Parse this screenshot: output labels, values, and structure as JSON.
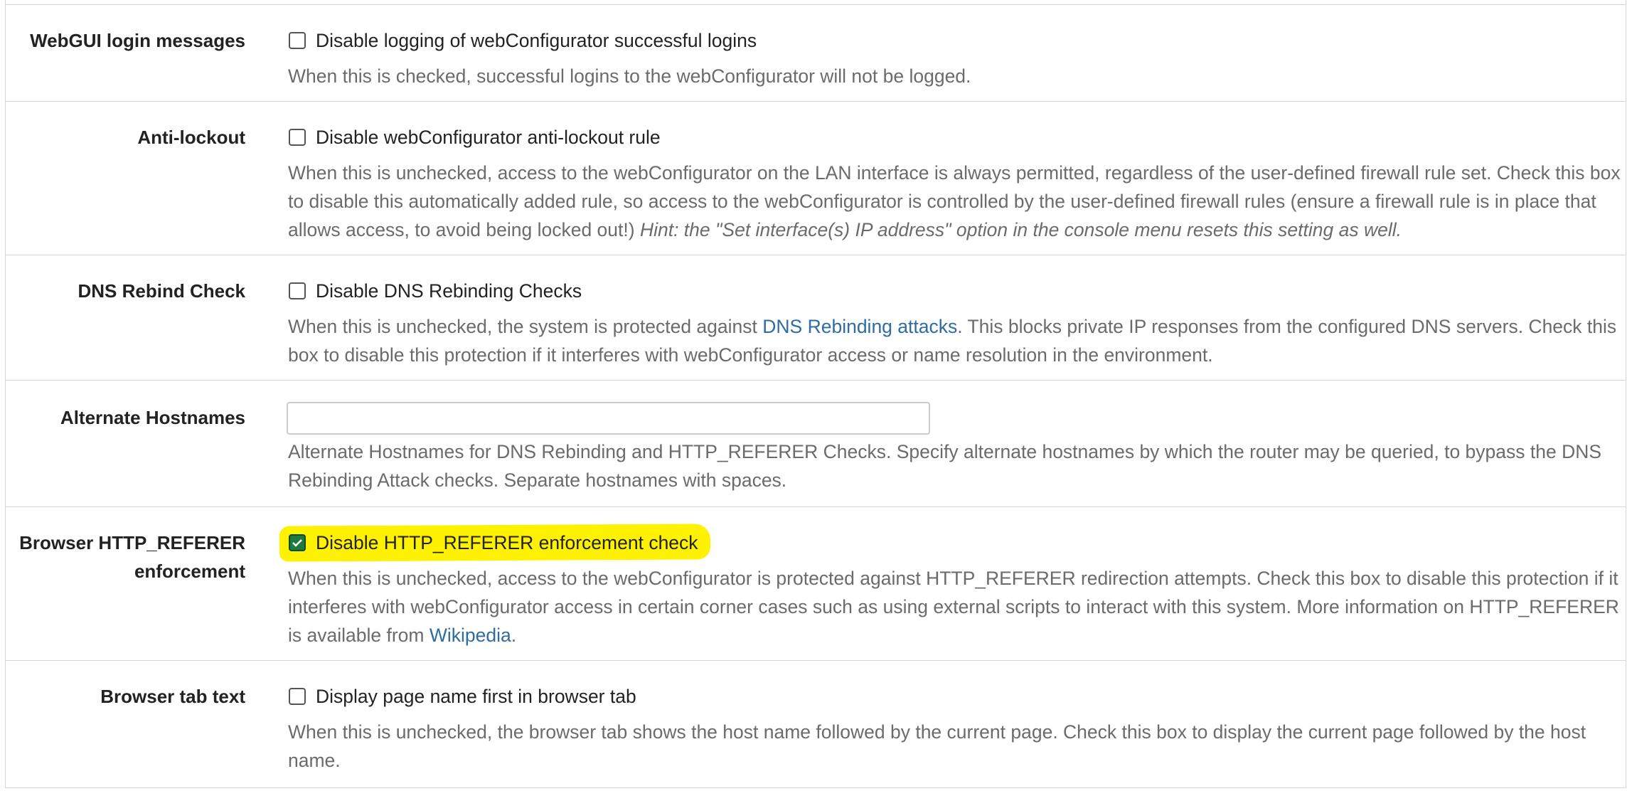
{
  "rows": [
    {
      "label": "WebGUI login messages",
      "checkbox_label": "Disable logging of webConfigurator successful logins",
      "checked": false,
      "help": "When this is checked, successful logins to the webConfigurator will not be logged."
    },
    {
      "label": "Anti-lockout",
      "checkbox_label": "Disable webConfigurator anti-lockout rule",
      "checked": false,
      "help": "When this is unchecked, access to the webConfigurator on the LAN interface is always permitted, regardless of the user-defined firewall rule set. Check this box to disable this automatically added rule, so access to the webConfigurator is controlled by the user-defined firewall rules (ensure a firewall rule is in place that allows access, to avoid being locked out!)",
      "hint": "Hint: the \"Set interface(s) IP address\" option in the console menu resets this setting as well."
    },
    {
      "label": "DNS Rebind Check",
      "checkbox_label": "Disable DNS Rebinding Checks",
      "checked": false,
      "help_before": "When this is unchecked, the system is protected against",
      "help_link": "DNS Rebinding attacks",
      "help_after": ". This blocks private IP responses from the configured DNS servers. Check this box to disable this protection if it interferes with webConfigurator access or name resolution in the environment."
    },
    {
      "label": "Alternate Hostnames",
      "input_value": "",
      "help": "Alternate Hostnames for DNS Rebinding and HTTP_REFERER Checks. Specify alternate hostnames by which the router may be queried, to bypass the DNS Rebinding Attack checks. Separate hostnames with spaces."
    },
    {
      "label": "Browser HTTP_REFERER enforcement",
      "label_line1": "Browser HTTP_REFERER",
      "label_line2": "enforcement",
      "checkbox_label": "Disable HTTP_REFERER enforcement check",
      "checked": true,
      "highlighted": true,
      "help_before": "When this is unchecked, access to the webConfigurator is protected against HTTP_REFERER redirection attempts. Check this box to disable this protection if it interferes with webConfigurator access in certain corner cases such as using external scripts to interact with this system. More information on HTTP_REFERER is available from",
      "help_link": "Wikipedia",
      "help_after": "."
    },
    {
      "label": "Browser tab text",
      "checkbox_label": "Display page name first in browser tab",
      "checked": false,
      "help": "When this is unchecked, the browser tab shows the host name followed by the current page. Check this box to display the current page followed by the host name."
    }
  ],
  "colors": {
    "link": "#2e6ca4",
    "help_text": "#6b6b6b",
    "highlight": "#fff200",
    "checked_box": "#1f7a3e"
  }
}
